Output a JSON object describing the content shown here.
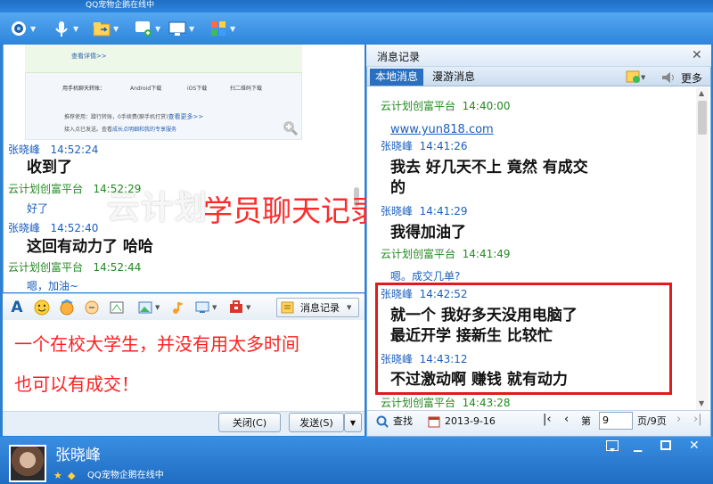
{
  "window": {
    "top_status": "QQ宠物企鹅在线中"
  },
  "ad": {
    "details_link": "查看详情>>",
    "download_label": "用手机聊天转账：",
    "downloads": [
      "Android下载",
      "iOS下载",
      "扫二维码下载"
    ],
    "recommend_link": "查看更多>>",
    "note1": "推荐使用：蹭行转账，0手续费(聊手机打赏)",
    "note2": "接入点已发送。查看",
    "note2_link": "成长点明细和我的专享服务"
  },
  "chat": {
    "messages": [
      {
        "sender": "张晓峰",
        "time": "14:52:24",
        "text": "收到了"
      },
      {
        "sender": "云计划创富平台",
        "time": "14:52:29",
        "text": "好了"
      },
      {
        "sender": "张晓峰",
        "time": "14:52:40",
        "text": "这回有动力了    哈哈"
      },
      {
        "sender": "云计划创富平台",
        "time": "14:52:44",
        "text": "嗯，加油~"
      }
    ],
    "overlay_white": "云计划",
    "overlay_red": "学员聊天记录"
  },
  "format_bar": {
    "history_button": "消息记录"
  },
  "input": {
    "line1": "一个在校大学生，并没有用太多时间",
    "line2": "也可以有成交！"
  },
  "buttons": {
    "close": "关闭(C)",
    "send": "发送(S)"
  },
  "history": {
    "title": "消息记录",
    "tabs": {
      "local": "本地消息",
      "roam": "漫游消息"
    },
    "more": "更多",
    "entries": [
      {
        "sender": "云计划创富平台",
        "time": "14:40:00",
        "text": "www.yun818.com"
      },
      {
        "sender": "张晓峰",
        "time": "14:41:26",
        "text": "我去  好几天不上    竟然  有成交",
        "text2": "的"
      },
      {
        "sender": "张晓峰",
        "time": "14:41:29",
        "text": "我得加油了"
      },
      {
        "sender": "云计划创富平台",
        "time": "14:41:49",
        "text": "嗯。成交几单?"
      },
      {
        "sender": "张晓峰",
        "time": "14:42:52",
        "text": "就一个    我好多天没用电脑了",
        "text2": "最近开学    接新生  比较忙"
      },
      {
        "sender": "张晓峰",
        "time": "14:43:12",
        "text": "不过激动啊     赚钱       就有动力"
      },
      {
        "sender": "云计划创富平台",
        "time": "14:43:28"
      }
    ],
    "footer": {
      "search": "查找",
      "date": "2013-9-16",
      "page_prefix": "第",
      "page_value": "9",
      "page_suffix": "页/9页"
    }
  },
  "profile": {
    "name": "张晓峰",
    "status": "QQ宠物企鹅在线中"
  },
  "colors": {
    "accent": "#2d85db",
    "highlight_red": "#e01b1b",
    "link_blue": "#1a5fbe",
    "sender_green": "#1f8a1f"
  }
}
